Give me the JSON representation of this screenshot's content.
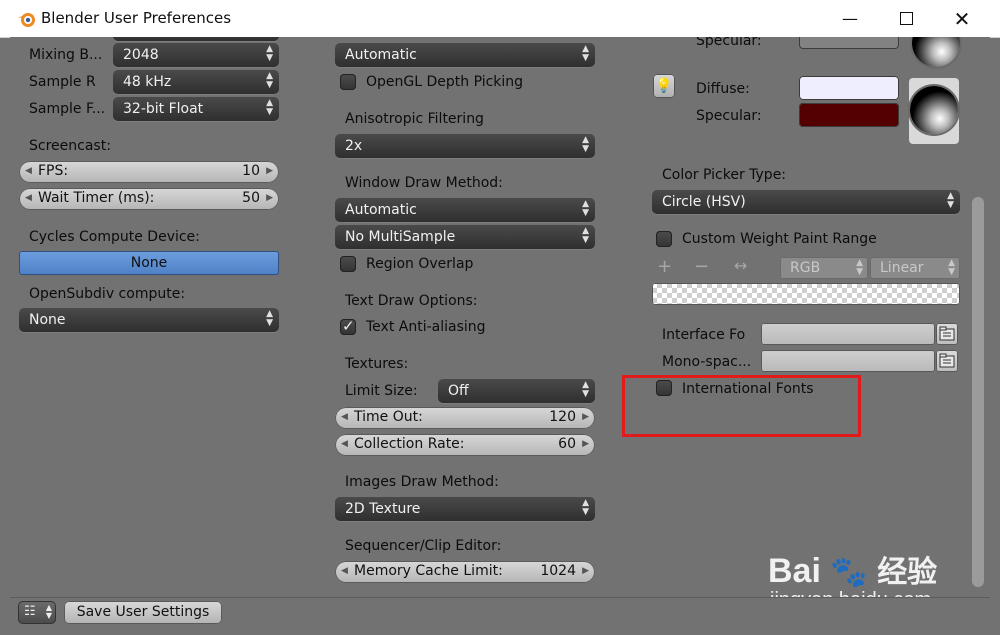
{
  "window": {
    "title": "Blender User Preferences"
  },
  "system": {
    "left": {
      "mixing_buffer": {
        "label": "Mixing B...",
        "value": "2048"
      },
      "sample_rate": {
        "label": "Sample R",
        "value": "48 kHz"
      },
      "sample_format": {
        "label": "Sample F...",
        "value": "32-bit Float"
      },
      "screencast": {
        "label": "Screencast:",
        "fps_label": "FPS:",
        "fps_value": "10",
        "wait_label": "Wait Timer (ms):",
        "wait_value": "50"
      },
      "cycles": {
        "label": "Cycles Compute Device:",
        "value": "None"
      },
      "opensubdiv": {
        "label": "OpenSubdiv compute:",
        "value": "None"
      }
    },
    "middle": {
      "top_menu_value": "Automatic",
      "opengl_depth_label": "OpenGL Depth Picking",
      "aniso": {
        "label": "Anisotropic Filtering",
        "value": "2x"
      },
      "window_draw": {
        "label": "Window Draw Method:",
        "value": "Automatic",
        "multisample": "No MultiSample",
        "region_overlap": "Region Overlap"
      },
      "text_draw": {
        "label": "Text Draw Options:",
        "antialias": "Text Anti-aliasing"
      },
      "textures": {
        "label": "Textures:",
        "limit_label": "Limit Size:",
        "limit_value": "Off",
        "timeout_label": "Time Out:",
        "timeout_value": "120",
        "collection_label": "Collection Rate:",
        "collection_value": "60"
      },
      "images_draw": {
        "label": "Images Draw Method:",
        "value": "2D Texture"
      },
      "sequencer": {
        "label": "Sequencer/Clip Editor:",
        "mem_label": "Memory Cache Limit:",
        "mem_value": "1024"
      }
    },
    "right": {
      "specular_top_label": "Specular:",
      "diffuse_label": "Diffuse:",
      "specular_label": "Specular:",
      "diffuse_color": "#eeeefe",
      "specular_color": "#540000",
      "color_picker": {
        "label": "Color Picker Type:",
        "value": "Circle (HSV)"
      },
      "custom_weight_label": "Custom Weight Paint Range",
      "ramp": {
        "mode": "RGB",
        "interp": "Linear"
      },
      "interface_font_label": "Interface Fo",
      "mono_font_label": "Mono-spac...",
      "international_fonts_label": "International Fonts"
    }
  },
  "footer": {
    "save_label": "Save User Settings"
  },
  "watermark": {
    "brand": "Bai",
    "brand_cn": "经验",
    "url": "jingyan.baidu.com"
  },
  "colors": {
    "accent_blue": "#5c8ed4",
    "highlight_red": "#e31a1a"
  }
}
